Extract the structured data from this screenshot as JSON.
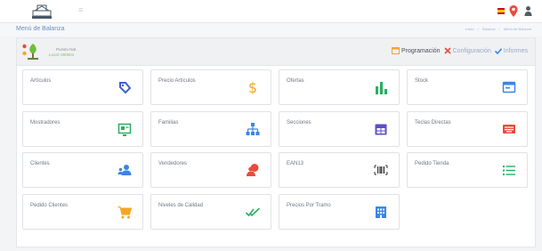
{
  "header": {
    "toggle_glyph": "≡",
    "icons": [
      "logo",
      "spain-flag-icon",
      "location-pin-icon",
      "user-icon"
    ],
    "brand_color": "#4a7fcf"
  },
  "subheader": {
    "title": "Menú de Balanza",
    "breadcrumbs": [
      "Inicio",
      "Balanza",
      "Menú de Balanza"
    ]
  },
  "store": {
    "name": "Puesto Nat",
    "code": "Local: 000001"
  },
  "actions": [
    {
      "label": "Programación",
      "icon": "programming-icon",
      "color": "#f5a623"
    },
    {
      "label": "Configuración",
      "icon": "tools-icon",
      "color": "#e74c3c"
    },
    {
      "label": "Informes",
      "icon": "check-icon",
      "color": "#3a86e8"
    }
  ],
  "tiles": [
    {
      "label": "Artículos",
      "icon": "tag-icon",
      "color": "#3e5fcf"
    },
    {
      "label": "Precio Artículos",
      "icon": "dollar-icon",
      "color": "#f5a623"
    },
    {
      "label": "Ofertas",
      "icon": "bar-chart-icon",
      "color": "#27ae60"
    },
    {
      "label": "Stock",
      "icon": "stock-icon",
      "color": "#3a86e8"
    },
    {
      "label": "Mostradores",
      "icon": "counter-icon",
      "color": "#27ae60"
    },
    {
      "label": "Familias",
      "icon": "sitemap-icon",
      "color": "#3a86e8"
    },
    {
      "label": "Secciones",
      "icon": "calendar-icon",
      "color": "#5b4fc4"
    },
    {
      "label": "Teclas Directas",
      "icon": "keyboard-icon",
      "color": "#e74c3c"
    },
    {
      "label": "Clientes",
      "icon": "users-icon",
      "color": "#3a86e8"
    },
    {
      "label": "Vendedores",
      "icon": "seller-icon",
      "color": "#e74c3c"
    },
    {
      "label": "EAN13",
      "icon": "barcode-icon",
      "color": "#333333"
    },
    {
      "label": "Pedido Tienda",
      "icon": "list-icon",
      "color": "#27ae60"
    },
    {
      "label": "Pedido Clientes",
      "icon": "cart-icon",
      "color": "#f5a623"
    },
    {
      "label": "Niveles de Calidad",
      "icon": "double-check-icon",
      "color": "#27ae60"
    },
    {
      "label": "Precios Por Tramo",
      "icon": "building-icon",
      "color": "#3a86e8"
    }
  ]
}
